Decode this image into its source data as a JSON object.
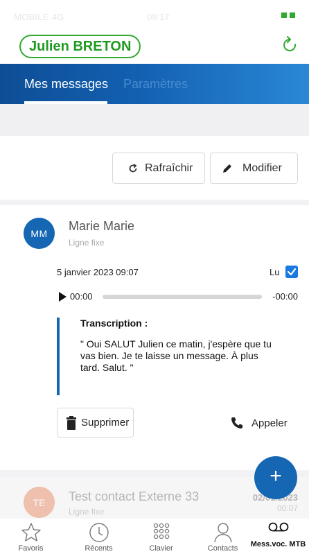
{
  "status_bar": {
    "carrier": "MOBILE 4G",
    "time": "09:17"
  },
  "header": {
    "user_name": "Julien BRETON"
  },
  "tabs": [
    {
      "label": "Mes messages",
      "active": true
    },
    {
      "label": "Paramètres",
      "active": false
    }
  ],
  "toolbar": {
    "refresh_label": "Rafraîchir",
    "edit_label": "Modifier"
  },
  "message": {
    "initials": "MM",
    "contact_name": "Marie Marie",
    "line_type": "Ligne fixe",
    "date": "5 janvier 2023 09:07",
    "read_label": "Lu",
    "read": true,
    "player": {
      "current": "00:00",
      "remaining": "-00:00",
      "progress": 0
    },
    "transcription_title": "Transcription :",
    "transcription_text": "\" Oui SALUT Julien ce matin, j'espère que tu vas bien. Je te laisse un message. À plus tard. Salut. \"",
    "delete_label": "Supprimer",
    "call_label": "Appeler"
  },
  "message2": {
    "initials": "TE",
    "contact_name": "Test contact Externe 33",
    "line_type": "Ligne fixe",
    "date": "02/01/2023",
    "duration": "00:07"
  },
  "fab": {
    "label": "+"
  },
  "nav": [
    {
      "label": "Favoris",
      "icon": "star-icon"
    },
    {
      "label": "Récents",
      "icon": "clock-icon"
    },
    {
      "label": "Clavier",
      "icon": "keypad-icon"
    },
    {
      "label": "Contacts",
      "icon": "person-icon"
    },
    {
      "label": "Mess.voc. MTB",
      "icon": "voicemail-icon",
      "active": true
    }
  ],
  "colors": {
    "brand_green": "#2faa2f",
    "brand_blue": "#1566b3",
    "avatar_orange": "#e8642b"
  }
}
